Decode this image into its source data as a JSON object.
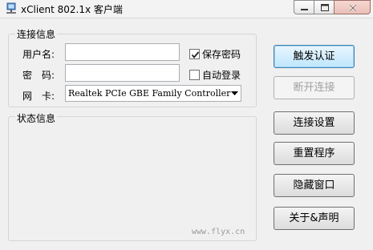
{
  "window": {
    "title": "xClient 802.1x 客户端"
  },
  "connection": {
    "group_label": "连接信息",
    "username_label": "用户名:",
    "username_value": "",
    "password_label": "密　码:",
    "password_value": "",
    "nic_label": "网　卡:",
    "nic_selected": "Realtek PCIe GBE Family Controller",
    "save_password_label": "保存密码",
    "save_password_checked": true,
    "auto_login_label": "自动登录",
    "auto_login_checked": false
  },
  "status": {
    "group_label": "状态信息",
    "watermark": "www.flyx.cn"
  },
  "buttons": {
    "trigger_auth": "触发认证",
    "disconnect": "断开连接",
    "conn_settings": "连接设置",
    "restart": "重置程序",
    "hide_window": "隐藏窗口",
    "about": "关于&声明"
  }
}
